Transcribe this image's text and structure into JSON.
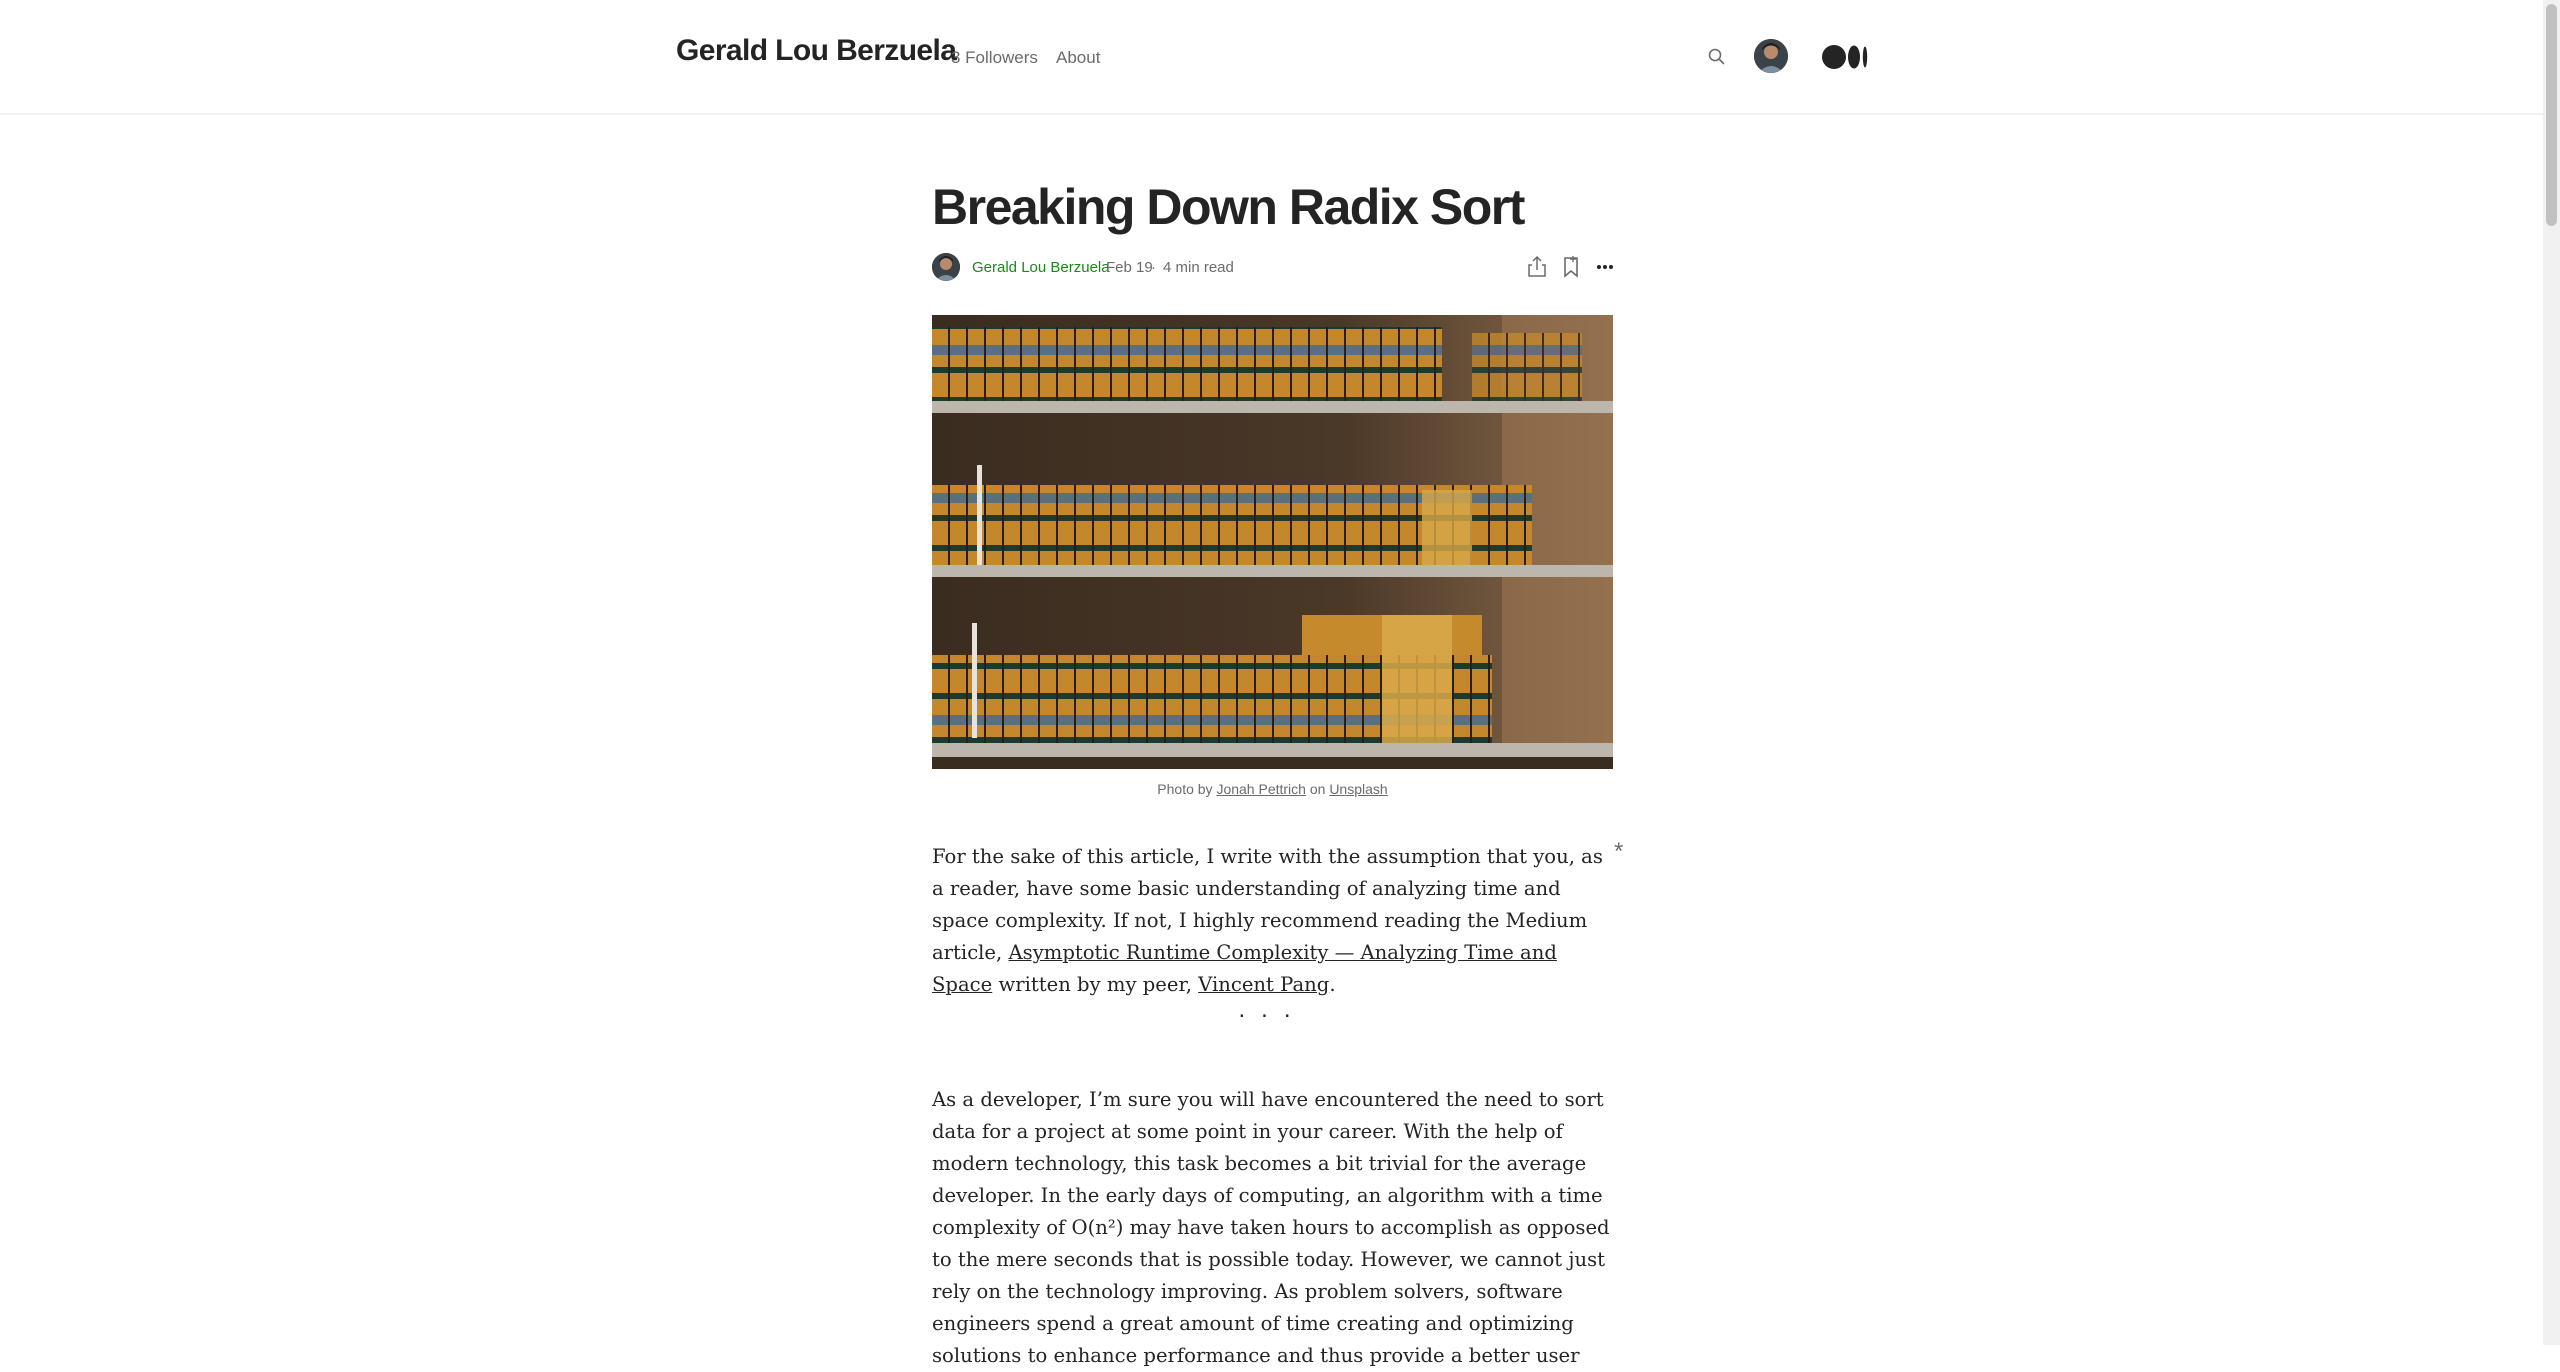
{
  "header": {
    "brand": "Gerald Lou Berzuela",
    "followers": "3 Followers",
    "about": "About",
    "icons": [
      "search-icon",
      "avatar",
      "medium-logo-icon"
    ]
  },
  "article": {
    "title": "Breaking Down Radix Sort",
    "author": "Gerald Lou Berzuela",
    "date": "Feb 19",
    "dot": "·",
    "read_time": "4 min read",
    "action_icons": [
      "share-icon",
      "bookmark-icon",
      "more-icon"
    ],
    "image": {
      "caption_prefix": "Photo by",
      "caption_author": "Jonah Pettrich",
      "caption_mid": "on",
      "caption_source": "Unsplash"
    },
    "p1": {
      "t1": "For the sake of this article, I write with the assumption that you, as a reader, have some basic understanding of analyzing time and space complexity. If not, I highly recommend reading the Medium article, ",
      "link1": "Asymptotic Runtime Complexity — Analyzing Time and Space",
      "t2": " written by my peer, ",
      "link2": "Vincent Pang",
      "t3": "."
    },
    "note_marker": "*",
    "separator": "...",
    "p2": "As a developer, I’m sure you will have encountered the need to sort data for a project at some point in your career. With the help of modern technology, this task becomes a bit trivial for the average developer. In the early days of computing, an algorithm with a time complexity of O(n²) may have taken hours to accomplish as opposed to the mere seconds that is possible today. However, we cannot just rely on the technology improving. As problem solvers, software engineers spend a great amount of time creating and optimizing solutions to enhance performance and thus provide a better user"
  },
  "colors": {
    "accent_green": "#1a8917",
    "text": "#242424",
    "muted": "#6b6b6b"
  }
}
